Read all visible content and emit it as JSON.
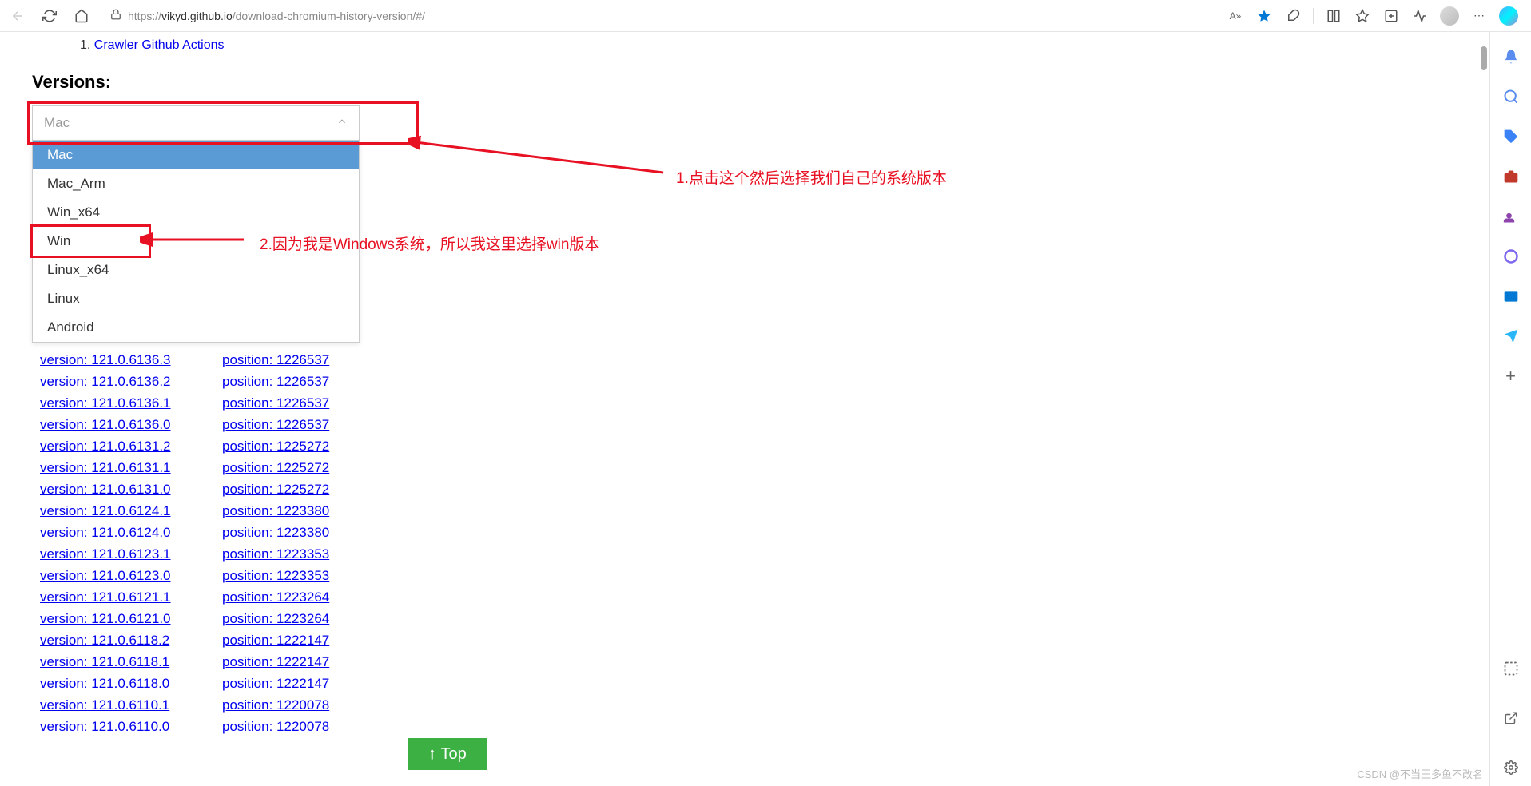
{
  "browser": {
    "url_prefix": "https://",
    "url_host": "vikyd.github.io",
    "url_path": "/download-chromium-history-version/#/",
    "read_aloud": "A»"
  },
  "page": {
    "partial_prefix": "1. ",
    "partial_link": "Crawler Github Actions",
    "section_title": "Versions:",
    "dropdown_value": "Mac",
    "options": [
      "Mac",
      "Mac_Arm",
      "Win_x64",
      "Win",
      "Linux_x64",
      "Linux",
      "Android"
    ],
    "highlighted_index": 0,
    "red_box_option_index": 3
  },
  "annotations": {
    "a1": "1.点击这个然后选择我们自己的系统版本",
    "a2": "2.因为我是Windows系统，所以我这里选择win版本"
  },
  "versions": [
    {
      "v": "121.0.6136.3",
      "p": "1226537"
    },
    {
      "v": "121.0.6136.2",
      "p": "1226537"
    },
    {
      "v": "121.0.6136.1",
      "p": "1226537"
    },
    {
      "v": "121.0.6136.0",
      "p": "1226537"
    },
    {
      "v": "121.0.6131.2",
      "p": "1225272"
    },
    {
      "v": "121.0.6131.1",
      "p": "1225272"
    },
    {
      "v": "121.0.6131.0",
      "p": "1225272"
    },
    {
      "v": "121.0.6124.1",
      "p": "1223380"
    },
    {
      "v": "121.0.6124.0",
      "p": "1223380"
    },
    {
      "v": "121.0.6123.1",
      "p": "1223353"
    },
    {
      "v": "121.0.6123.0",
      "p": "1223353"
    },
    {
      "v": "121.0.6121.1",
      "p": "1223264"
    },
    {
      "v": "121.0.6121.0",
      "p": "1223264"
    },
    {
      "v": "121.0.6118.2",
      "p": "1222147"
    },
    {
      "v": "121.0.6118.1",
      "p": "1222147"
    },
    {
      "v": "121.0.6118.0",
      "p": "1222147"
    },
    {
      "v": "121.0.6110.1",
      "p": "1220078"
    },
    {
      "v": "121.0.6110.0",
      "p": "1220078"
    }
  ],
  "labels": {
    "version_prefix": "version: ",
    "position_prefix": "position: ",
    "top_button": "↑ Top"
  },
  "watermark": "CSDN @不当王多鱼不改名"
}
